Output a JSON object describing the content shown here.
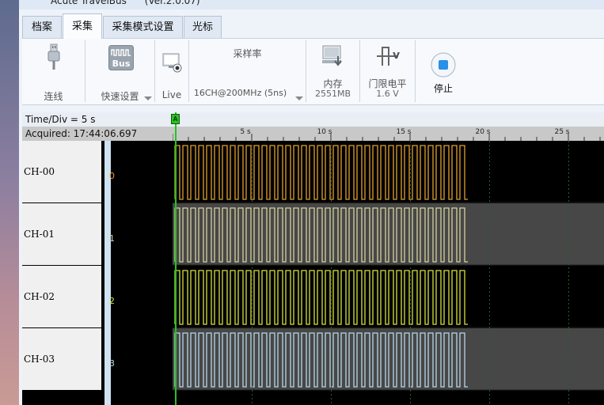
{
  "window": {
    "title": "Acute TravelBus      (Ver.2.0.07)"
  },
  "tabs": [
    {
      "label": "档案",
      "active": false
    },
    {
      "label": "采集",
      "active": true
    },
    {
      "label": "采集模式设置",
      "active": false
    },
    {
      "label": "光标",
      "active": false
    }
  ],
  "ribbon": {
    "connect_label": "连线",
    "quick_setup_label": "快速设置",
    "bus_icon_text": "Bus",
    "live_label": "Live",
    "sample_rate_title": "采样率",
    "sample_rate_value": "16CH@200MHz (5ns)",
    "memory_label": "内存",
    "memory_value": "2551MB",
    "threshold_label": "门限电平",
    "threshold_value": "1.6 V",
    "stop_label": "停止"
  },
  "waveform": {
    "time_div": "Time/Div = 5 s",
    "acquired": "Acquired: 17:44:06.697",
    "cursor_marker": "A",
    "ruler_ticks": [
      "5 s",
      "10 s",
      "15 s",
      "20 s",
      "25 s"
    ],
    "channels": [
      {
        "name": "CH-00",
        "index": "0",
        "color": "#e0a030"
      },
      {
        "name": "CH-01",
        "index": "1",
        "color": "#d8d0a0"
      },
      {
        "name": "CH-02",
        "index": "2",
        "color": "#d8e040"
      },
      {
        "name": "CH-03",
        "index": "3",
        "color": "#b8d8e8"
      }
    ]
  },
  "colors": {
    "accent_green": "#27c21f",
    "tab_active": "#fbfcfe"
  }
}
